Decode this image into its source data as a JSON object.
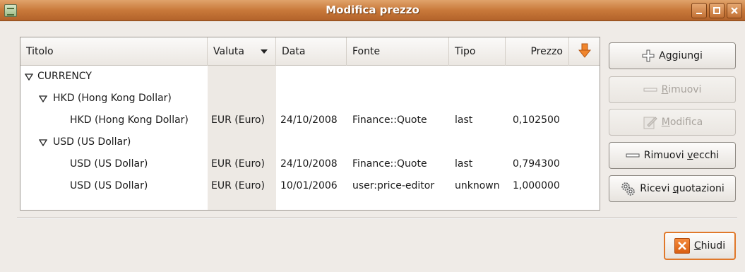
{
  "window": {
    "title": "Modifica prezzo",
    "controls": {
      "minimize": "_",
      "maximize": "□",
      "close": "×"
    }
  },
  "table": {
    "columns": {
      "titolo": "Titolo",
      "valuta": "Valuta",
      "data": "Data",
      "fonte": "Fonte",
      "tipo": "Tipo",
      "prezzo": "Prezzo"
    },
    "group": "CURRENCY",
    "subgroups": {
      "hkd": "HKD (Hong Kong Dollar)",
      "usd": "USD (US Dollar)"
    },
    "rows": [
      {
        "titolo": "HKD (Hong Kong Dollar)",
        "valuta": "EUR (Euro)",
        "data": "24/10/2008",
        "fonte": "Finance::Quote",
        "tipo": "last",
        "prezzo": "0,102500"
      },
      {
        "titolo": "USD (US Dollar)",
        "valuta": "EUR (Euro)",
        "data": "24/10/2008",
        "fonte": "Finance::Quote",
        "tipo": "last",
        "prezzo": "0,794300"
      },
      {
        "titolo": "USD (US Dollar)",
        "valuta": "EUR (Euro)",
        "data": "10/01/2006",
        "fonte": "user:price-editor",
        "tipo": "unknown",
        "prezzo": "1,000000"
      }
    ]
  },
  "buttons": {
    "add": {
      "pre": "A",
      "key": "g",
      "post": "giungi"
    },
    "remove": {
      "pre": "",
      "key": "R",
      "post": "imuovi"
    },
    "edit": {
      "pre": "",
      "key": "M",
      "post": "odifica"
    },
    "remove_old": {
      "pre": "Rimuovi ",
      "key": "v",
      "post": "ecchi"
    },
    "get_quotes": {
      "pre": "Ricevi ",
      "key": "q",
      "post": "uotazioni"
    },
    "close": {
      "pre": "",
      "key": "C",
      "post": "hiudi"
    }
  },
  "colors": {
    "titlebar": "#c9793a",
    "accent_orange": "#e0782a",
    "sorted_column": "#ede9e4"
  }
}
